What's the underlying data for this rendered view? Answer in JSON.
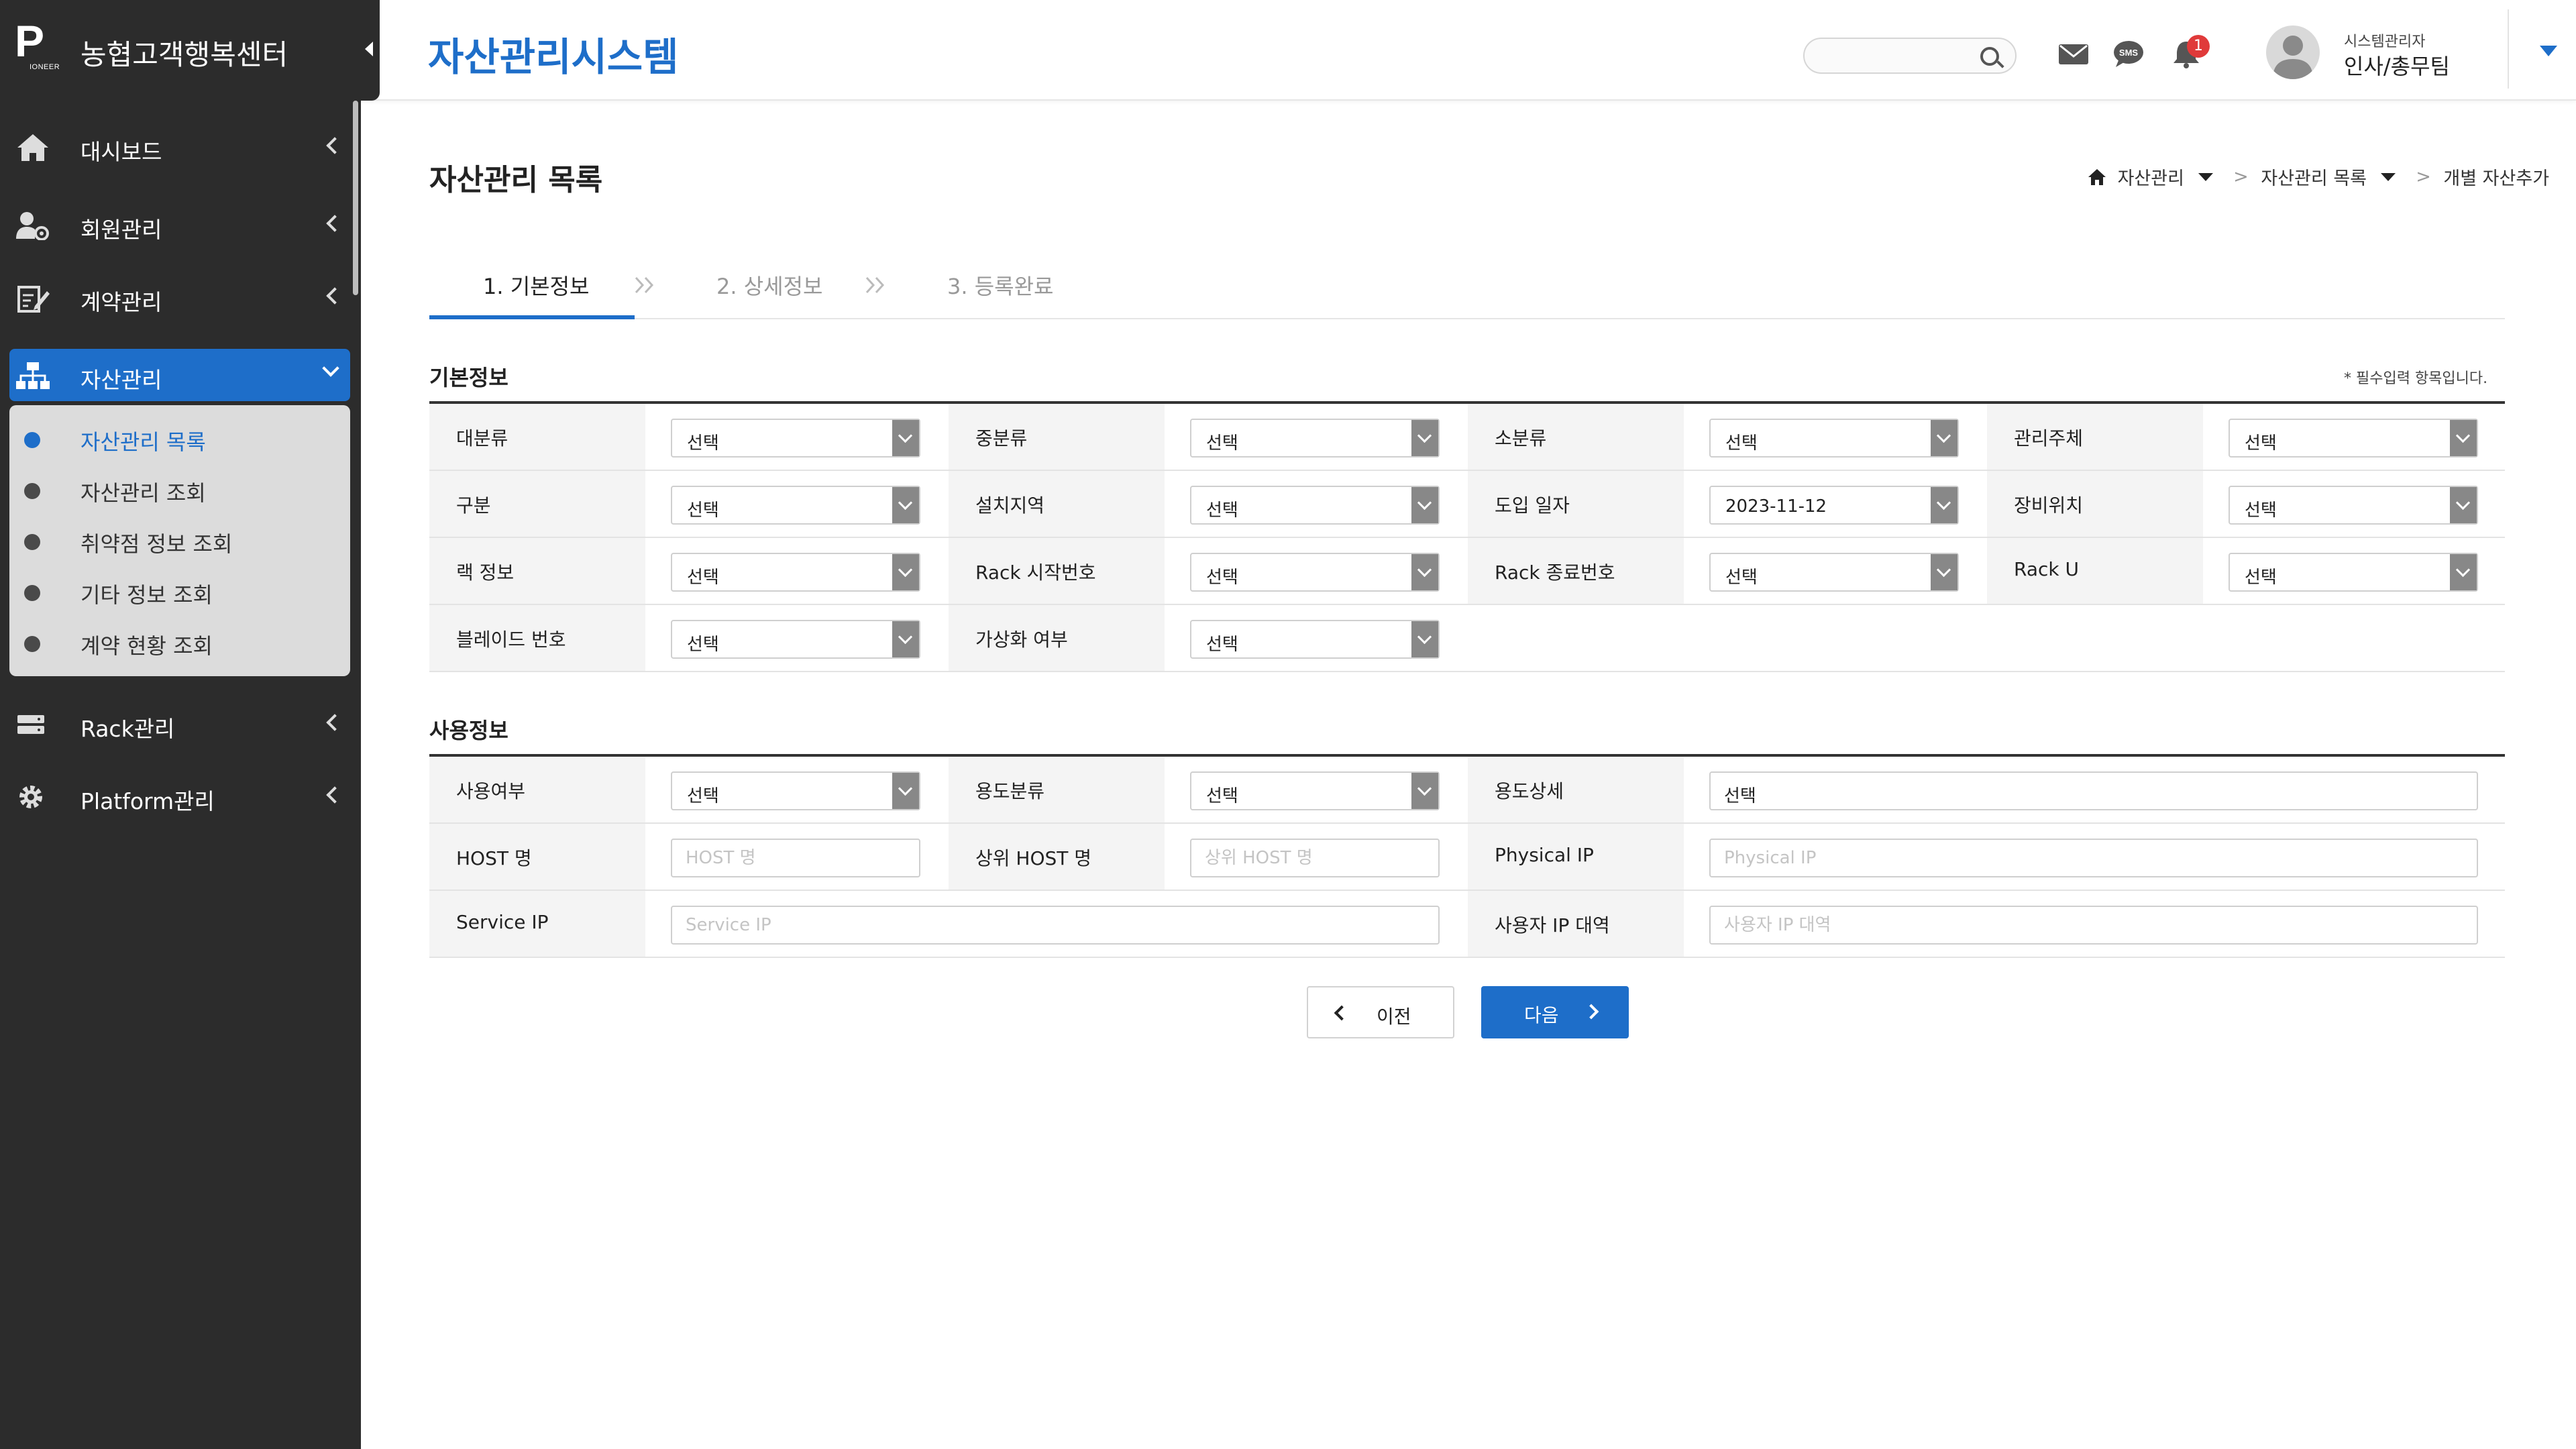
{
  "brand": {
    "logo_letter": "P",
    "logo_sub": "IONEER",
    "title": "농협고객행복센터"
  },
  "sidebar": {
    "items": [
      {
        "label": "대시보드",
        "icon": "home-icon"
      },
      {
        "label": "회원관리",
        "icon": "user-gear-icon"
      },
      {
        "label": "계약관리",
        "icon": "contract-icon"
      },
      {
        "label": "자산관리",
        "icon": "network-icon",
        "active": true
      },
      {
        "label": "Rack관리",
        "icon": "server-icon"
      },
      {
        "label": "Platform관리",
        "icon": "gear-icon"
      }
    ],
    "submenu": [
      {
        "label": "자산관리 목록",
        "active": true
      },
      {
        "label": "자산관리 조회"
      },
      {
        "label": "취약점 정보 조회"
      },
      {
        "label": "기타 정보 조회"
      },
      {
        "label": "계약 현황 조회"
      }
    ]
  },
  "header": {
    "title": "자산관리시스템",
    "search_placeholder": "",
    "notification_count": "1",
    "sms_label": "SMS",
    "user_role": "시스템관리자",
    "user_name": "인사/총무팀"
  },
  "page": {
    "title": "자산관리 목록",
    "breadcrumb": [
      "자산관리",
      "자산관리 목록",
      "개별 자산추가"
    ],
    "breadcrumb_sep": ">"
  },
  "steps": [
    {
      "label": "1. 기본정보",
      "active": true
    },
    {
      "label": "2. 상세정보"
    },
    {
      "label": "3. 등록완료"
    }
  ],
  "basic_info": {
    "title": "기본정보",
    "required_note": "* 필수입력 항목입니다.",
    "rows": [
      [
        {
          "label": "대분류",
          "value": "선택"
        },
        {
          "label": "중분류",
          "value": "선택"
        },
        {
          "label": "소분류",
          "value": "선택"
        },
        {
          "label": "관리주체",
          "value": "선택"
        }
      ],
      [
        {
          "label": "구분",
          "value": "선택"
        },
        {
          "label": "설치지역",
          "value": "선택"
        },
        {
          "label": "도입 일자",
          "value": "2023-11-12"
        },
        {
          "label": "장비위치",
          "value": "선택"
        }
      ],
      [
        {
          "label": "랙 정보",
          "value": "선택"
        },
        {
          "label": "Rack 시작번호",
          "value": "선택"
        },
        {
          "label": "Rack 종료번호",
          "value": "선택"
        },
        {
          "label": "Rack U",
          "value": "선택"
        }
      ],
      [
        {
          "label": "블레이드 번호",
          "value": "선택"
        },
        {
          "label": "가상화 여부",
          "value": "선택"
        }
      ]
    ]
  },
  "usage_info": {
    "title": "사용정보",
    "use_yn": {
      "label": "사용여부",
      "value": "선택"
    },
    "purpose_type": {
      "label": "용도분류",
      "value": "선택"
    },
    "purpose_detail": {
      "label": "용도상세",
      "value": "선택"
    },
    "host_name": {
      "label": "HOST 명",
      "placeholder": "HOST 명"
    },
    "parent_host": {
      "label": "상위 HOST 명",
      "placeholder": "상위 HOST 명"
    },
    "physical_ip": {
      "label": "Physical IP",
      "placeholder": "Physical IP"
    },
    "service_ip": {
      "label": "Service IP",
      "placeholder": "Service IP"
    },
    "user_ip_range": {
      "label": "사용자 IP 대역",
      "placeholder": "사용자 IP 대역"
    }
  },
  "actions": {
    "prev": "이전",
    "next": "다음"
  },
  "colors": {
    "accent": "#1e6ec9",
    "sidebar_bg": "#2c2c2c",
    "badge": "#e03a3a"
  }
}
